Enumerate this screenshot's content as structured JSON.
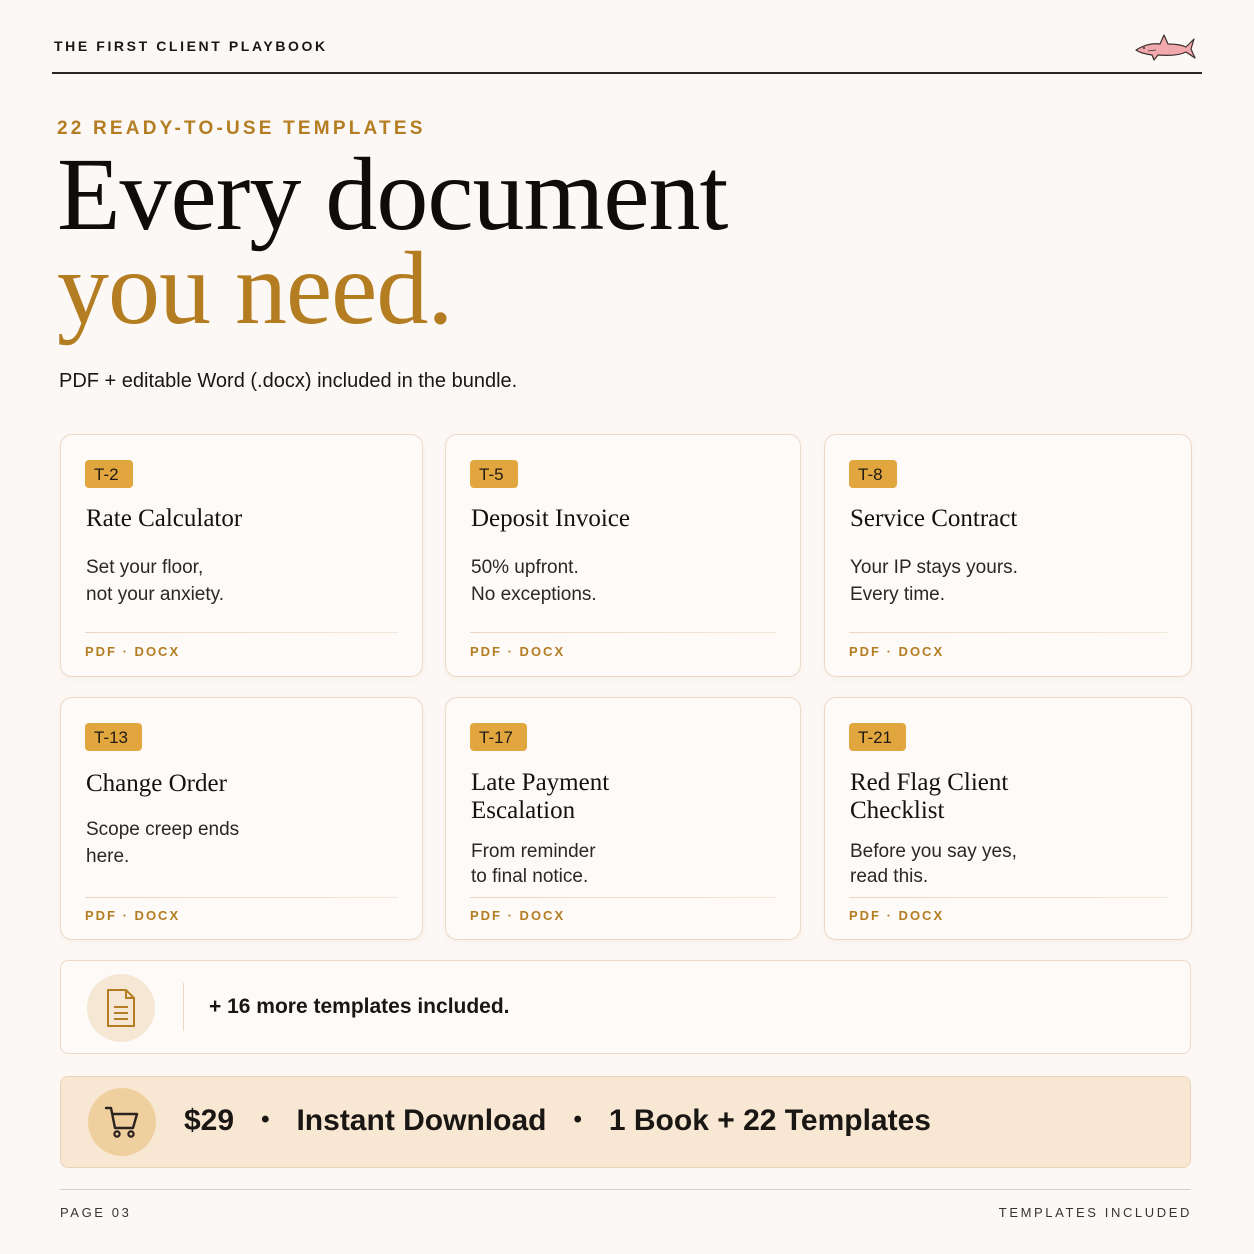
{
  "header": {
    "brand": "THE FIRST CLIENT PLAYBOOK",
    "logo_icon": "shark-icon"
  },
  "hero": {
    "eyebrow": "22 READY-TO-USE TEMPLATES",
    "headline_line1": "Every document",
    "headline_line2": "you need.",
    "subline": "PDF + editable Word (.docx) included in the bundle."
  },
  "templates": [
    {
      "code": "T-2",
      "title": "Rate Calculator",
      "description": "Set your floor,\nnot your anxiety.",
      "formats": "PDF · DOCX"
    },
    {
      "code": "T-5",
      "title": "Deposit Invoice",
      "description": "50% upfront.\nNo exceptions.",
      "formats": "PDF · DOCX"
    },
    {
      "code": "T-8",
      "title": "Service Contract",
      "description": "Your IP stays yours.\nEvery time.",
      "formats": "PDF · DOCX"
    },
    {
      "code": "T-13",
      "title": "Change Order",
      "description": "Scope creep ends\nhere.",
      "formats": "PDF · DOCX"
    },
    {
      "code": "T-17",
      "title": "Late Payment\nEscalation",
      "description": "From reminder\nto final notice.",
      "formats": "PDF · DOCX"
    },
    {
      "code": "T-21",
      "title": "Red Flag Client\nChecklist",
      "description": "Before you say yes,\nread this.",
      "formats": "PDF · DOCX"
    }
  ],
  "more": {
    "icon": "document-icon",
    "text": "+ 16 more templates included."
  },
  "purchase": {
    "icon": "cart-icon",
    "price": "$29",
    "separator": "•",
    "delivery": "Instant Download",
    "contents": "1 Book + 22 Templates"
  },
  "footer": {
    "page_label": "PAGE 03",
    "section_label": "TEMPLATES INCLUDED"
  },
  "colors": {
    "accent": "#b47d22",
    "badge": "#e2a63f",
    "background": "#fcf8f5",
    "buy_bar": "#f8e7d2"
  }
}
